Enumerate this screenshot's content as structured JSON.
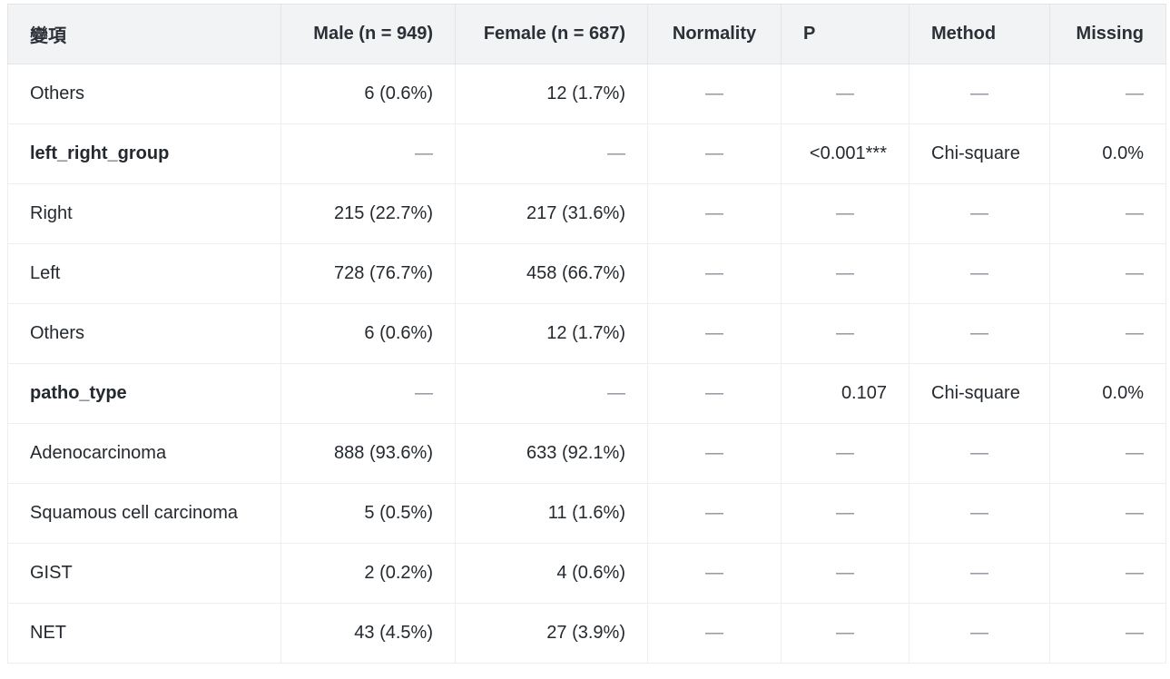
{
  "table": {
    "headers": [
      "變項",
      "Male (n = 949)",
      "Female (n = 687)",
      "Normality",
      "P",
      "Method",
      "Missing"
    ],
    "rows": [
      {
        "label": "Others",
        "bold": false,
        "cells": [
          "6 (0.6%)",
          "12 (1.7%)",
          "—",
          "—",
          "—",
          "—"
        ]
      },
      {
        "label": "left_right_group",
        "bold": true,
        "cells": [
          "—",
          "—",
          "—",
          "<0.001***",
          "Chi-square",
          "0.0%"
        ]
      },
      {
        "label": "Right",
        "bold": false,
        "cells": [
          "215 (22.7%)",
          "217 (31.6%)",
          "—",
          "—",
          "—",
          "—"
        ]
      },
      {
        "label": "Left",
        "bold": false,
        "cells": [
          "728 (76.7%)",
          "458 (66.7%)",
          "—",
          "—",
          "—",
          "—"
        ]
      },
      {
        "label": "Others",
        "bold": false,
        "cells": [
          "6 (0.6%)",
          "12 (1.7%)",
          "—",
          "—",
          "—",
          "—"
        ]
      },
      {
        "label": "patho_type",
        "bold": true,
        "cells": [
          "—",
          "—",
          "—",
          "0.107",
          "Chi-square",
          "0.0%"
        ]
      },
      {
        "label": "Adenocarcinoma",
        "bold": false,
        "cells": [
          "888 (93.6%)",
          "633 (92.1%)",
          "—",
          "—",
          "—",
          "—"
        ]
      },
      {
        "label": "Squamous cell carcinoma",
        "bold": false,
        "cells": [
          "5 (0.5%)",
          "11 (1.6%)",
          "—",
          "—",
          "—",
          "—"
        ]
      },
      {
        "label": "GIST",
        "bold": false,
        "cells": [
          "2 (0.2%)",
          "4 (0.6%)",
          "—",
          "—",
          "—",
          "—"
        ]
      },
      {
        "label": "NET",
        "bold": false,
        "cells": [
          "43 (4.5%)",
          "27 (3.9%)",
          "—",
          "—",
          "—",
          "—"
        ]
      }
    ]
  }
}
